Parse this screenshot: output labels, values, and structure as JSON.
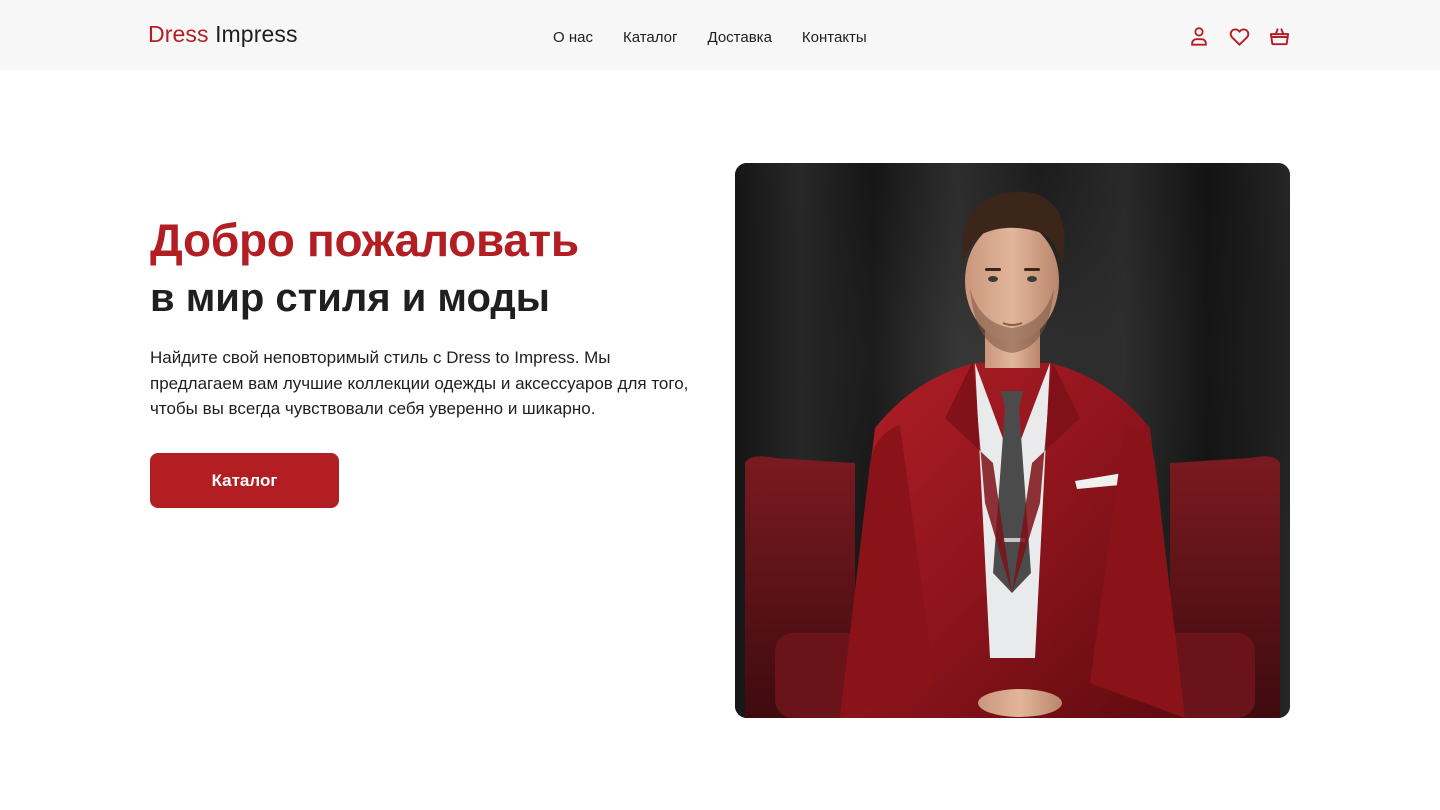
{
  "header": {
    "logo_accent": "Dress",
    "logo_rest": "Impress",
    "nav": [
      {
        "label": "О нас"
      },
      {
        "label": "Каталог"
      },
      {
        "label": "Доставка"
      },
      {
        "label": "Контакты"
      }
    ],
    "icons": [
      "user-icon",
      "heart-icon",
      "cart-icon"
    ]
  },
  "hero": {
    "title_accent": "Добро пожаловать",
    "title_rest": "в мир стиля и моды",
    "text": "Найдите свой неповторимый стиль с Dress to Impress. Мы предлагаем вам лучшие коллекции одежды и аксессуаров для того, чтобы вы всегда чувствовали себя уверенно и шикарно.",
    "button_label": "Каталог",
    "image_subject": "man-in-red-suit-photo"
  },
  "colors": {
    "accent": "#b31e22",
    "header_bg": "#f7f7f7",
    "text": "#1f1f1f"
  }
}
